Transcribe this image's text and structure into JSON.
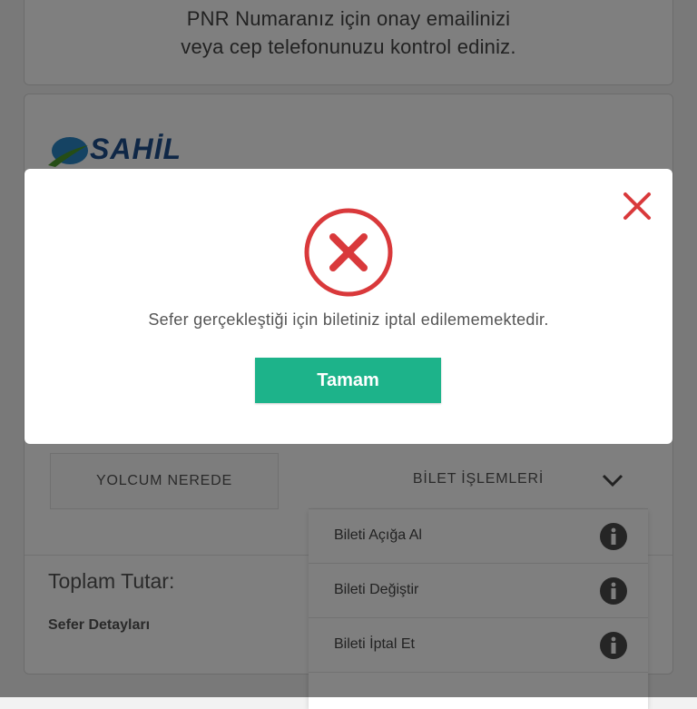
{
  "pnr_notice": {
    "line1": "PNR Numaranız için onay emailinizi",
    "line2": "veya cep telefonunuzu kontrol ediniz."
  },
  "ticket": {
    "logo_text": "SAHİL",
    "yolcum_button": "YOLCUM NEREDE",
    "bilet_islemleri": "BİLET İŞLEMLERİ",
    "menu_items": [
      {
        "label": "Bileti Açığa Al",
        "icon": "info-icon"
      },
      {
        "label": "Bileti Değiştir",
        "icon": "info-icon"
      },
      {
        "label": "Bileti İptal Et",
        "icon": "info-icon"
      }
    ],
    "total_label": "Toplam Tutar:",
    "details_label": "Sefer Detayları"
  },
  "modal": {
    "message": "Sefer gerçekleştiği için biletiniz iptal edilememektedir.",
    "ok_label": "Tamam",
    "icon": "error-x-icon",
    "close_icon": "close-icon"
  },
  "colors": {
    "accent_green": "#1db38a",
    "error_red": "#d9393b",
    "brand_blue": "#1f4e8c"
  }
}
